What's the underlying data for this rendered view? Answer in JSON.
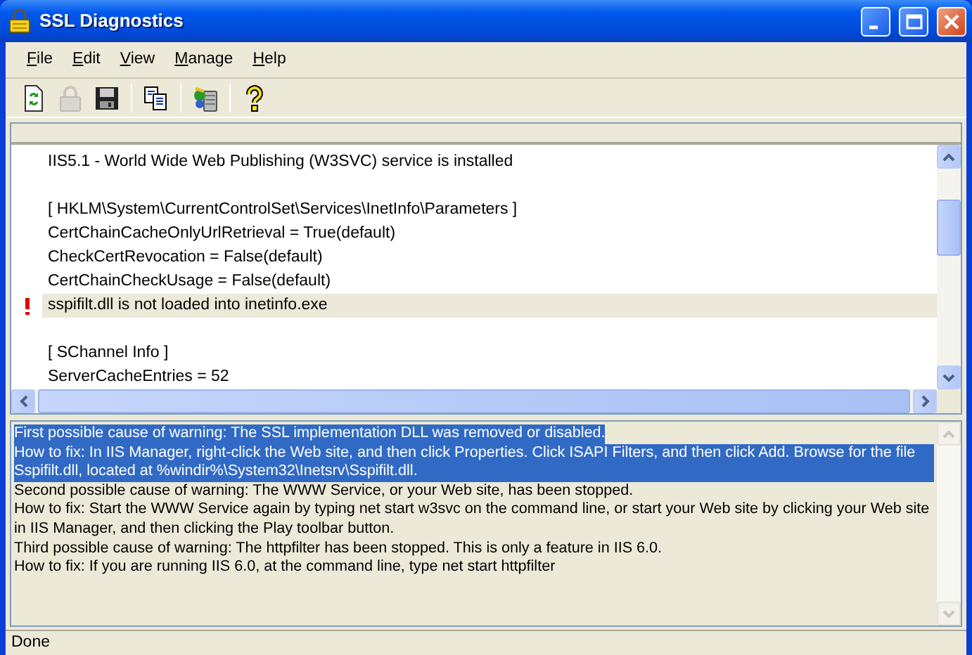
{
  "window": {
    "title": "SSL Diagnostics"
  },
  "menu": [
    "File",
    "Edit",
    "View",
    "Manage",
    "Help"
  ],
  "toolbar": [
    {
      "kind": "refresh",
      "disabled": false
    },
    {
      "kind": "lock",
      "disabled": true
    },
    {
      "kind": "save",
      "disabled": false
    },
    {
      "kind": "copy",
      "disabled": false
    },
    {
      "kind": "server",
      "disabled": false
    },
    {
      "kind": "help",
      "disabled": false
    }
  ],
  "log": [
    {
      "kind": "line",
      "text": "IIS5.1 - World Wide Web Publishing (W3SVC) service is installed",
      "warning": false
    },
    {
      "kind": "spacer"
    },
    {
      "kind": "line",
      "text": "[ HKLM\\System\\CurrentControlSet\\Services\\InetInfo\\Parameters ]",
      "warning": false
    },
    {
      "kind": "line",
      "text": "CertChainCacheOnlyUrlRetrieval = True(default)",
      "warning": false
    },
    {
      "kind": "line",
      "text": "CheckCertRevocation = False(default)",
      "warning": false
    },
    {
      "kind": "line",
      "text": "CertChainCheckUsage = False(default)",
      "warning": false
    },
    {
      "kind": "line",
      "text": "sspifilt.dll is not loaded into inetinfo.exe",
      "warning": true
    },
    {
      "kind": "spacer"
    },
    {
      "kind": "line",
      "text": "[ SChannel Info ]",
      "warning": false
    },
    {
      "kind": "line",
      "text": "ServerCacheEntries = 52",
      "warning": false
    }
  ],
  "details": [
    {
      "text": "First possible cause of warning: The SSL implementation DLL was removed or disabled.",
      "selected": true
    },
    {
      "text": "How to fix: In IIS Manager, right-click the Web site, and then click Properties. Click ISAPI Filters, and then click Add. Browse for the file Sspifilt.dll, located at %windir%\\System32\\Inetsrv\\Sspifilt.dll.",
      "selected": true
    },
    {
      "text": "Second possible cause of warning: The WWW Service, or your Web site, has been stopped.",
      "selected": false
    },
    {
      "text": "How to fix: Start the WWW Service again by typing net start w3svc on the command line, or start your Web site by clicking your Web site in IIS Manager, and then clicking the Play toolbar button.",
      "selected": false
    },
    {
      "text": "Third possible cause of warning: The httpfilter has been stopped. This is only a feature in IIS 6.0.",
      "selected": false
    },
    {
      "text": "How to fix: If you are running IIS 6.0, at the command line, type net start httpfilter",
      "selected": false
    }
  ],
  "status_bar": "Done"
}
